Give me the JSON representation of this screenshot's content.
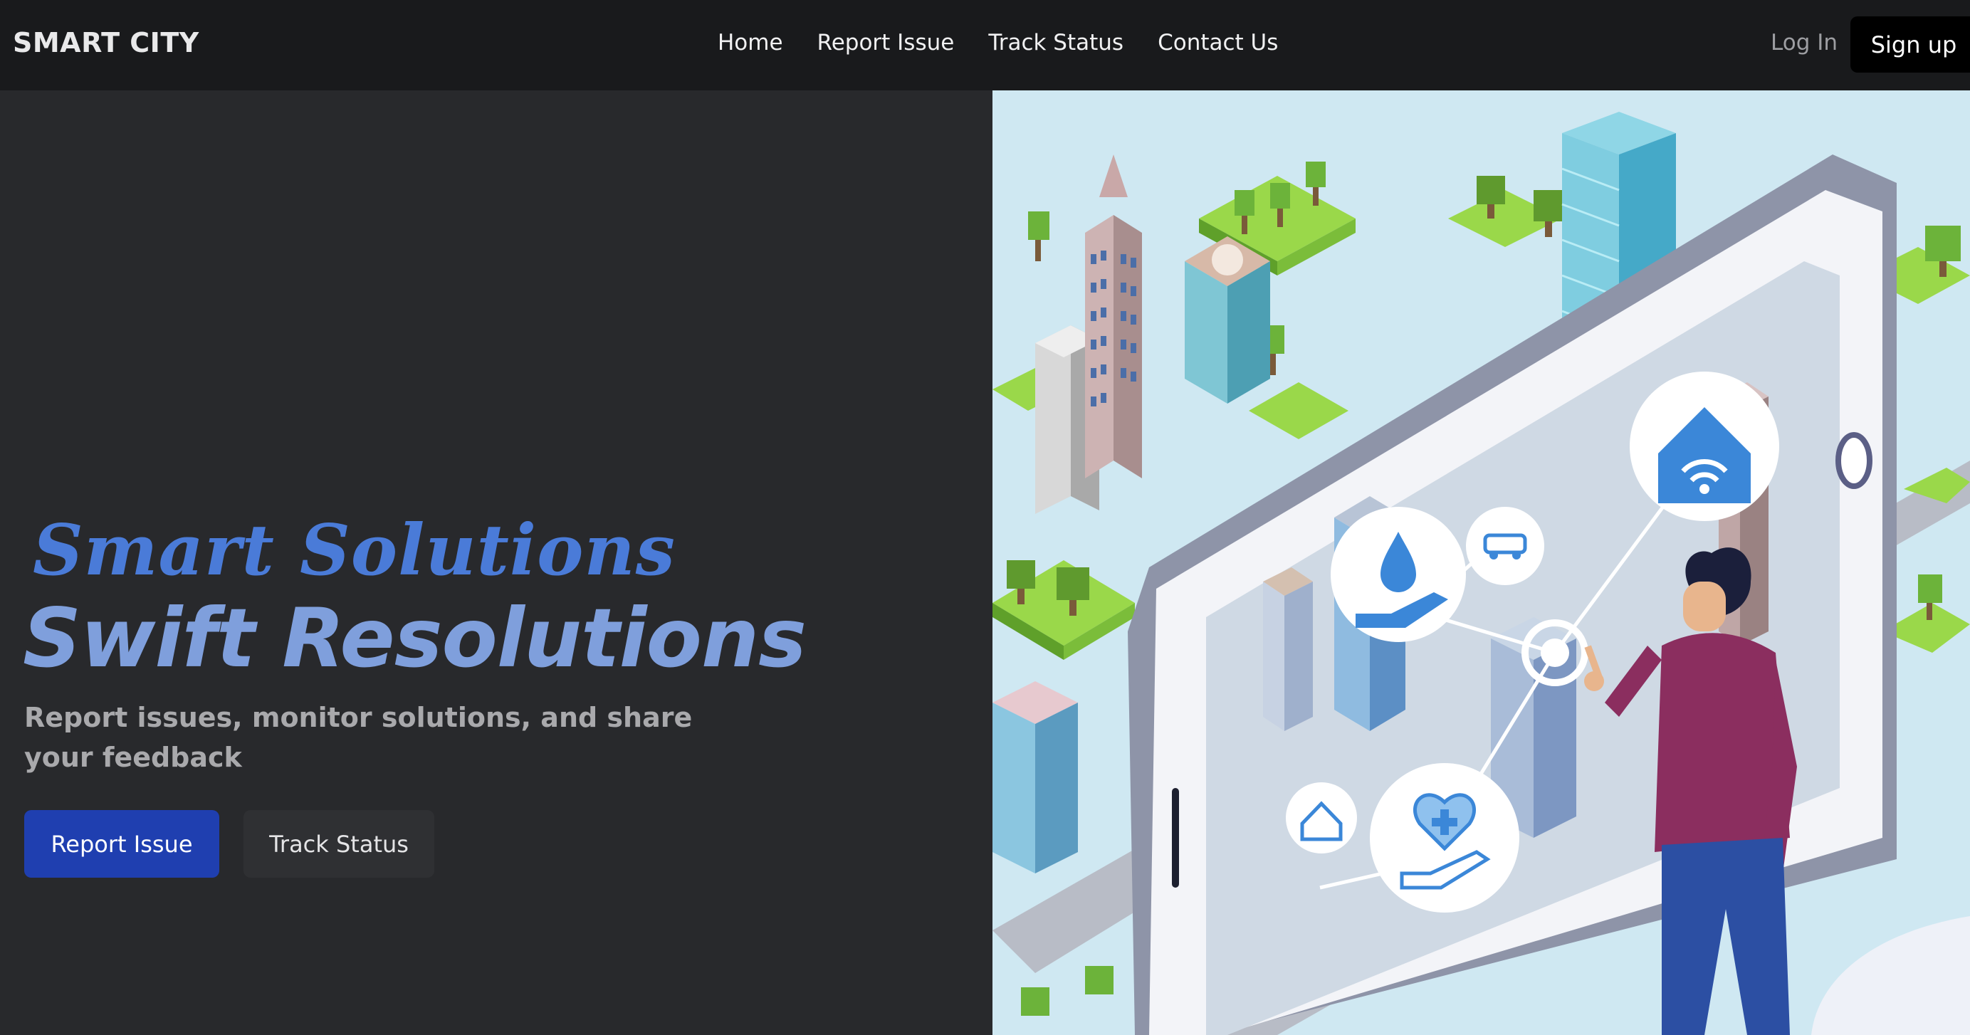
{
  "brand": "SMART CITY",
  "nav": {
    "links": [
      "Home",
      "Report Issue",
      "Track Status",
      "Contact Us"
    ],
    "login": "Log In",
    "signup": "Sign up"
  },
  "hero": {
    "heading_line1": "Smart Solutions",
    "heading_line2": "Swift Resolutions",
    "subtitle": "Report issues, monitor solutions, and share your feedback",
    "primary_button": "Report Issue",
    "secondary_button": "Track Status"
  },
  "colors": {
    "nav_bg": "#191a1c",
    "hero_bg": "#28292c",
    "heading_blue": "#4a7bd8",
    "heading_light_blue": "#7f9fdc",
    "primary_button": "#1f3fb0"
  },
  "illustration": {
    "icons": [
      "water-drop-hand-icon",
      "car-icon",
      "smart-home-wifi-icon",
      "home-icon",
      "healthcare-hand-icon",
      "touch-target-icon"
    ]
  }
}
